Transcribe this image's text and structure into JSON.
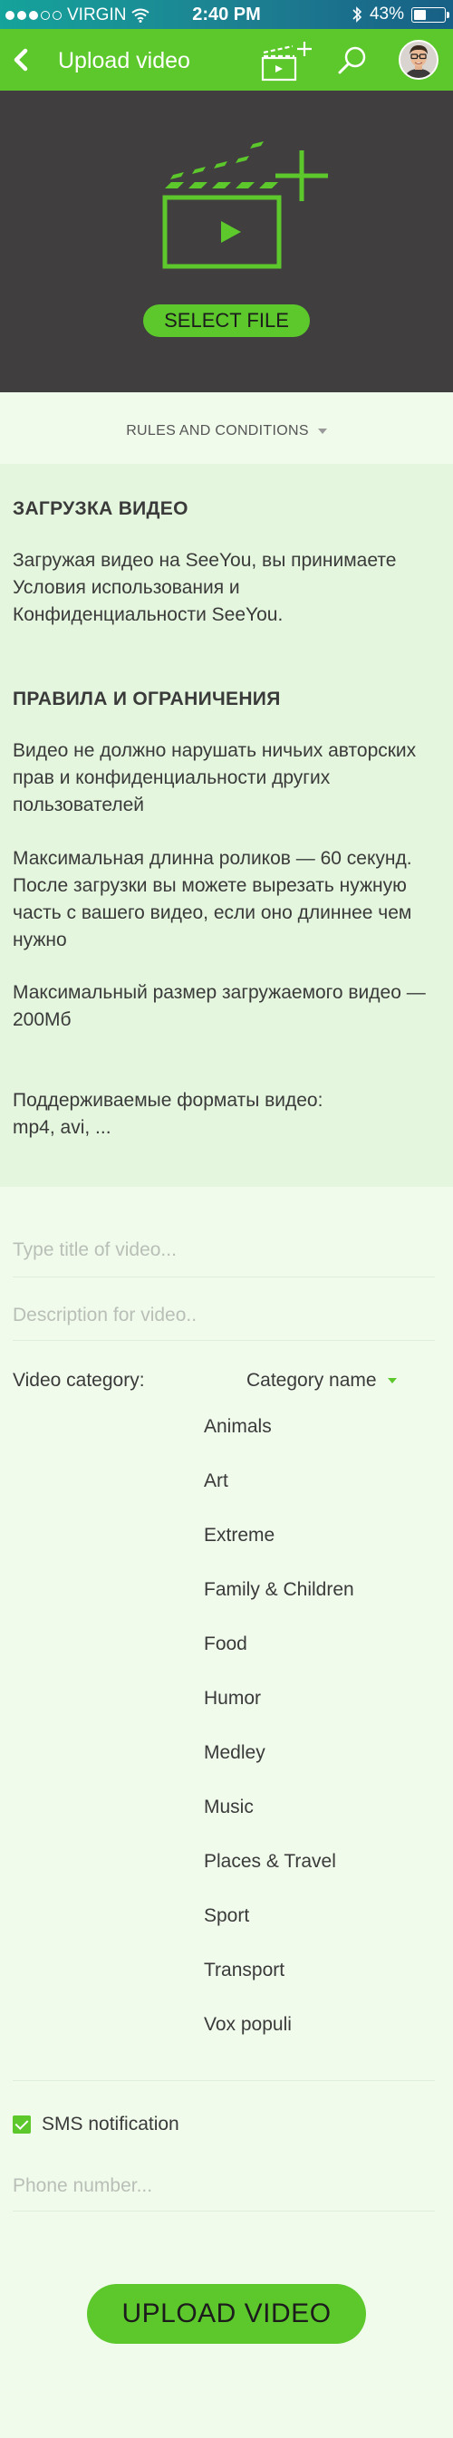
{
  "status_bar": {
    "carrier": "VIRGIN",
    "time": "2:40 PM",
    "battery": "43%",
    "battery_level": 0.43,
    "signal_bars_filled": 3,
    "signal_bars_total": 5,
    "icons": [
      "wifi-icon",
      "bluetooth-icon",
      "battery-icon"
    ]
  },
  "nav": {
    "title": "Upload video",
    "icons": [
      "back-arrow-icon",
      "add-video-icon",
      "search-icon",
      "avatar"
    ]
  },
  "hero": {
    "select_file_label": "SELECT FILE",
    "icon": "clapperboard-plus-icon"
  },
  "rules_toggle": {
    "label": "RULES AND CONDITIONS"
  },
  "rules": {
    "upload_heading": "ЗАГРУЗКА ВИДЕО",
    "upload_text": "Загружая видео на SeeYou, вы принимаете Условия использования и Конфиденциальности SeeYou.",
    "limits_heading": "ПРАВИЛА И ОГРАНИЧЕНИЯ",
    "limit_1": "Видео не должно нарушать ничьих авторских прав и конфиденциальности других пользователей",
    "limit_2": "Максимальная длинна роликов — 60 секунд. После загрузки вы можете вырезать нужную часть с вашего видео, если оно длиннее чем нужно",
    "limit_3": "Максимальный размер загружаемого видео — 200Мб",
    "formats_title": "Поддерживаемые форматы видео:",
    "formats_list": "mp4, avi, ..."
  },
  "form": {
    "title_placeholder": "Type title of video...",
    "description_placeholder": "Description for video..",
    "category_label": "Video category:",
    "category_value": "Category name",
    "categories": [
      "Animals",
      "Art",
      "Extreme",
      "Family & Children",
      "Food",
      "Humor",
      "Medley",
      "Music",
      "Places & Travel",
      "Sport",
      "Transport",
      "Vox populi"
    ],
    "sms_label": "SMS notification",
    "sms_checked": true,
    "phone_placeholder": "Phone number...",
    "upload_label": "UPLOAD VIDEO"
  },
  "colors": {
    "accent": "#5cc82b",
    "hero_bg": "#403e3f",
    "page_bg": "#f0fbec",
    "rules_bg": "#e4f6dd"
  }
}
